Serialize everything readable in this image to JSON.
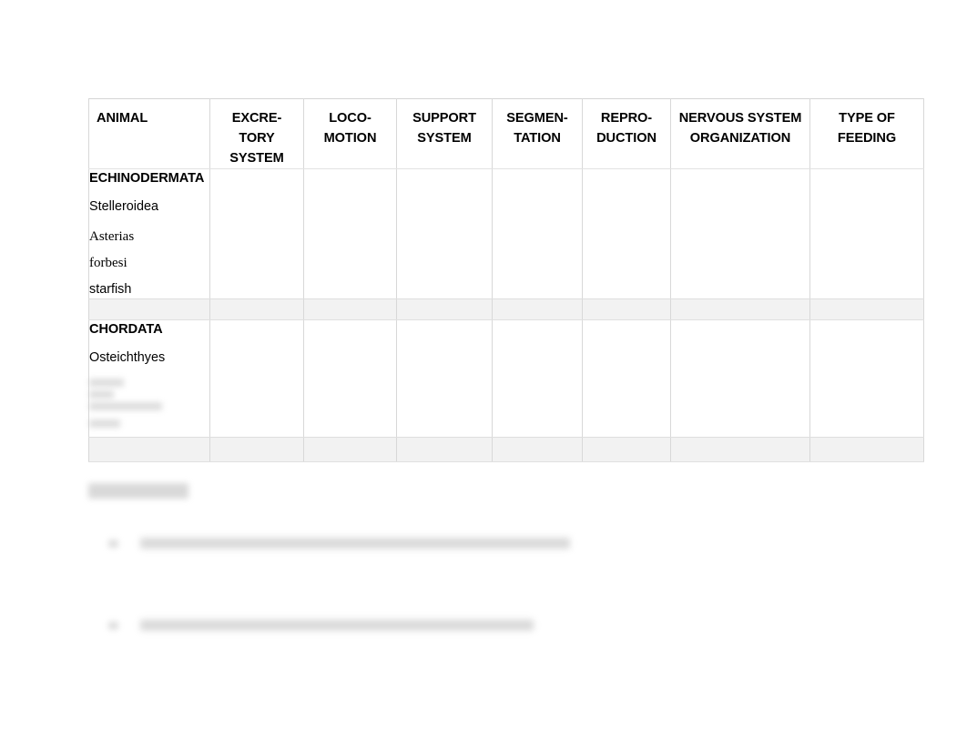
{
  "document": {
    "type": "worksheet-table",
    "background_color": "#ffffff",
    "table_border_color": "#d8d8d8"
  },
  "table": {
    "columns": [
      {
        "key": "animal",
        "lines": [
          "ANIMAL"
        ],
        "align": "left"
      },
      {
        "key": "excretory",
        "lines": [
          "EXCRE-",
          "TORY",
          "SYSTEM"
        ],
        "align": "center"
      },
      {
        "key": "locomotion",
        "lines": [
          "LOCO-",
          "MOTION"
        ],
        "align": "center"
      },
      {
        "key": "support",
        "lines": [
          "SUPPORT",
          "SYSTEM"
        ],
        "align": "center"
      },
      {
        "key": "segmentation",
        "lines": [
          "SEGMEN-",
          "TATION"
        ],
        "align": "center"
      },
      {
        "key": "reproduction",
        "lines": [
          "REPRO-",
          "DUCTION"
        ],
        "align": "center"
      },
      {
        "key": "nervous",
        "lines": [
          "NERVOUS SYSTEM",
          "ORGANIZATION"
        ],
        "align": "center"
      },
      {
        "key": "feeding",
        "lines": [
          "TYPE OF",
          "FEEDING"
        ],
        "align": "center"
      }
    ],
    "rows": [
      {
        "id": "row-echinodermata",
        "taxon": "ECHINODERMATA",
        "class_name": "Stelleroidea",
        "species_lines": [
          "Asterias",
          "forbesi"
        ],
        "common_name": "starfish",
        "cells": {
          "excretory": "",
          "locomotion": "",
          "support": "",
          "segmentation": "",
          "reproduction": "",
          "nervous": "",
          "feeding": ""
        }
      },
      {
        "id": "row-chordata",
        "taxon": "CHORDATA",
        "class_name": "Osteichthyes",
        "species_lines": [
          "",
          "",
          ""
        ],
        "common_name": "",
        "redacted": true,
        "cells": {
          "excretory": "",
          "locomotion": "",
          "support": "",
          "segmentation": "",
          "reproduction": "",
          "nervous": "",
          "feeding": ""
        }
      }
    ]
  },
  "questions": {
    "heading": "",
    "heading_redacted": true,
    "items": [
      {
        "number": "",
        "text": "",
        "redacted": true
      },
      {
        "number": "",
        "text": "",
        "redacted": true
      }
    ]
  }
}
